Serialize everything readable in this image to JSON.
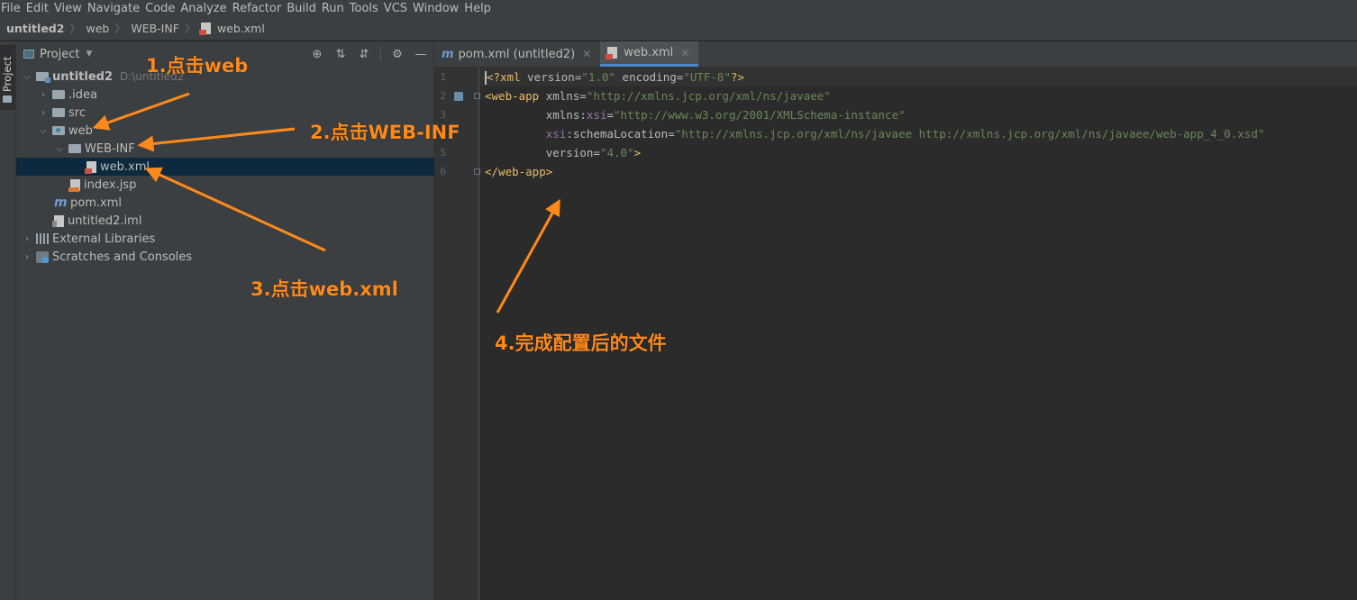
{
  "menu": [
    "File",
    "Edit",
    "View",
    "Navigate",
    "Code",
    "Analyze",
    "Refactor",
    "Build",
    "Run",
    "Tools",
    "VCS",
    "Window",
    "Help"
  ],
  "breadcrumb": [
    "untitled2",
    "web",
    "WEB-INF",
    "web.xml"
  ],
  "toolstrip": {
    "label": "Project"
  },
  "project_panel": {
    "title": "Project",
    "tree": [
      {
        "label": "untitled2",
        "path": "D:\\untitled2",
        "icon": "module-folder-icon",
        "arrow": "expanded"
      },
      {
        "label": ".idea",
        "icon": "folder-icon",
        "arrow": "collapsed"
      },
      {
        "label": "src",
        "icon": "folder-icon",
        "arrow": "collapsed"
      },
      {
        "label": "web",
        "icon": "web-folder-icon",
        "arrow": "expanded"
      },
      {
        "label": "WEB-INF",
        "icon": "folder-icon",
        "arrow": "expanded"
      },
      {
        "label": "web.xml",
        "icon": "xml-file-icon",
        "arrow": "none",
        "selected": true
      },
      {
        "label": "index.jsp",
        "icon": "jsp-file-icon",
        "arrow": "none"
      },
      {
        "label": "pom.xml",
        "icon": "maven-icon",
        "arrow": "none"
      },
      {
        "label": "untitled2.iml",
        "icon": "iml-file-icon",
        "arrow": "none"
      },
      {
        "label": "External Libraries",
        "icon": "libraries-icon",
        "arrow": "collapsed"
      },
      {
        "label": "Scratches and Consoles",
        "icon": "scratches-icon",
        "arrow": "collapsed"
      }
    ]
  },
  "editor": {
    "tabs": [
      {
        "label": "pom.xml (untitled2)",
        "icon": "maven-icon",
        "active": false
      },
      {
        "label": "web.xml",
        "icon": "xml-file-icon",
        "active": true
      }
    ],
    "line_numbers": [
      "1",
      "2",
      "3",
      "4",
      "5",
      "6"
    ],
    "code": {
      "l1": {
        "a": "<?xml ",
        "b": "version",
        "c": "=",
        "d": "\"1.0\"",
        "e": " ",
        "f": "encoding",
        "g": "=",
        "h": "\"UTF-8\"",
        "i": "?>"
      },
      "l2": {
        "a": "<web-app ",
        "b": "xmlns",
        "c": "=",
        "d": "\"http://xmlns.jcp.org/xml/ns/javaee\""
      },
      "l3": {
        "indent": "         ",
        "a": "xmlns",
        "b": ":",
        "c": "xsi",
        "d": "=",
        "e": "\"http://www.w3.org/2001/XMLSchema-instance\""
      },
      "l4": {
        "indent": "         ",
        "a": "xsi",
        "b": ":schemaLocation",
        "c": "=",
        "d": "\"http://xmlns.jcp.org/xml/ns/javaee http://xmlns.jcp.org/xml/ns/javaee/web-app_4_0.xsd\""
      },
      "l5": {
        "indent": "         ",
        "a": "version",
        "b": "=",
        "c": "\"4.0\"",
        "d": ">"
      },
      "l6": {
        "a": "</web-app>"
      }
    }
  },
  "annotations": {
    "step1": "1.点击web",
    "step2": "2.点击WEB-INF",
    "step3": "3.点击web.xml",
    "step4": "4.完成配置后的文件"
  },
  "colors": {
    "annotation": "#ff8a1a",
    "selection": "#0d293e",
    "accent": "#4a88c7"
  }
}
